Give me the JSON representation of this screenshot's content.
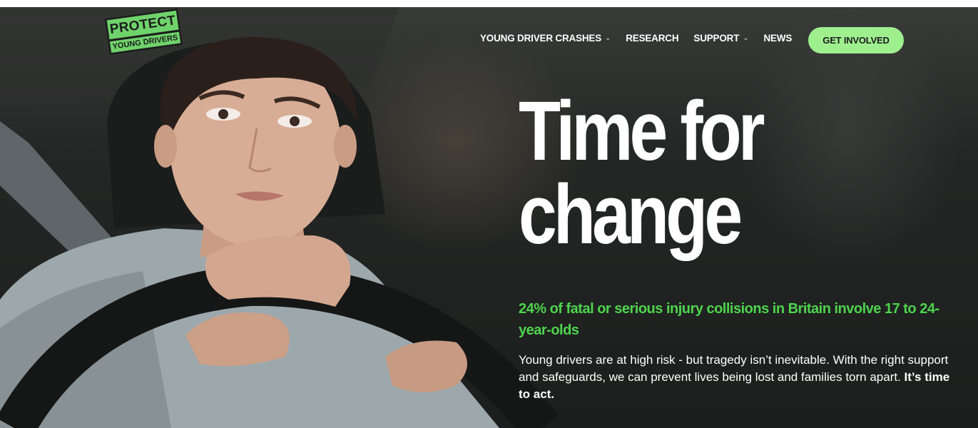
{
  "logo": {
    "line1": "PROTECT",
    "line2": "YOUNG DRIVERS"
  },
  "nav": {
    "items": [
      {
        "label": "YOUNG DRIVER CRASHES",
        "has_dropdown": true
      },
      {
        "label": "RESEARCH",
        "has_dropdown": false
      },
      {
        "label": "SUPPORT",
        "has_dropdown": true
      },
      {
        "label": "NEWS",
        "has_dropdown": false
      }
    ],
    "dropdown_icon": "chevron-down-icon",
    "cta_label": "GET INVOLVED"
  },
  "hero": {
    "headline_line1": "Time for",
    "headline_line2": "change",
    "stat": "24% of fatal or serious injury collisions in Britain involve 17 to 24-year-olds",
    "body": "Young drivers are at high risk - but tragedy isn’t inevitable. With the right support and safeguards, we can prevent lives being lost and families torn apart.",
    "body_emphasis": "It’s time to act."
  },
  "colors": {
    "accent_green": "#4dd44d",
    "cta_green": "#9ef08f",
    "logo_green": "#6fd36b",
    "text_white": "#ffffff",
    "background_dark": "#222423"
  }
}
